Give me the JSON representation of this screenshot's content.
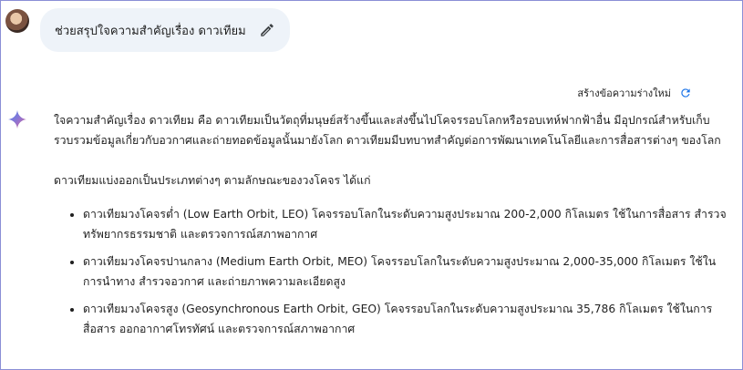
{
  "user": {
    "prompt": "ช่วยสรุปใจความสำคัญเรื่อง ดาวเทียม"
  },
  "response": {
    "redraft_label": "สร้างข้อความร่างใหม่",
    "paragraph1": "ใจความสำคัญเรื่อง ดาวเทียม คือ ดาวเทียมเป็นวัตถุที่มนุษย์สร้างขึ้นและส่งขึ้นไปโคจรรอบโลกหรือรอบเทห์ฟากฟ้าอื่น มีอุปกรณ์สำหรับเก็บรวบรวมข้อมูลเกี่ยวกับอวกาศและถ่ายทอดข้อมูลนั้นมายังโลก ดาวเทียมมีบทบาทสำคัญต่อการพัฒนาเทคโนโลยีและการสื่อสารต่างๆ ของโลก",
    "paragraph2": "ดาวเทียมแบ่งออกเป็นประเภทต่างๆ ตามลักษณะของวงโคจร ได้แก่",
    "bullets": [
      "ดาวเทียมวงโคจรต่ำ (Low Earth Orbit, LEO) โคจรรอบโลกในระดับความสูงประมาณ 200-2,000 กิโลเมตร ใช้ในการสื่อสาร สำรวจทรัพยากรธรรมชาติ และตรวจการณ์สภาพอากาศ",
      "ดาวเทียมวงโคจรปานกลาง (Medium Earth Orbit, MEO) โคจรรอบโลกในระดับความสูงประมาณ 2,000-35,000 กิโลเมตร ใช้ในการนำทาง สำรวจอวกาศ และถ่ายภาพความละเอียดสูง",
      "ดาวเทียมวงโคจรสูง (Geosynchronous Earth Orbit, GEO) โคจรรอบโลกในระดับความสูงประมาณ 35,786 กิโลเมตร ใช้ในการสื่อสาร ออกอากาศโทรทัศน์ และตรวจการณ์สภาพอากาศ"
    ]
  },
  "icons": {
    "edit": "pencil-icon",
    "redraft": "refresh-icon",
    "assistant": "sparkle-icon"
  },
  "colors": {
    "bubble": "#eef3f9",
    "accent_blue": "#1a73e8",
    "frame": "#8a8fd6"
  }
}
